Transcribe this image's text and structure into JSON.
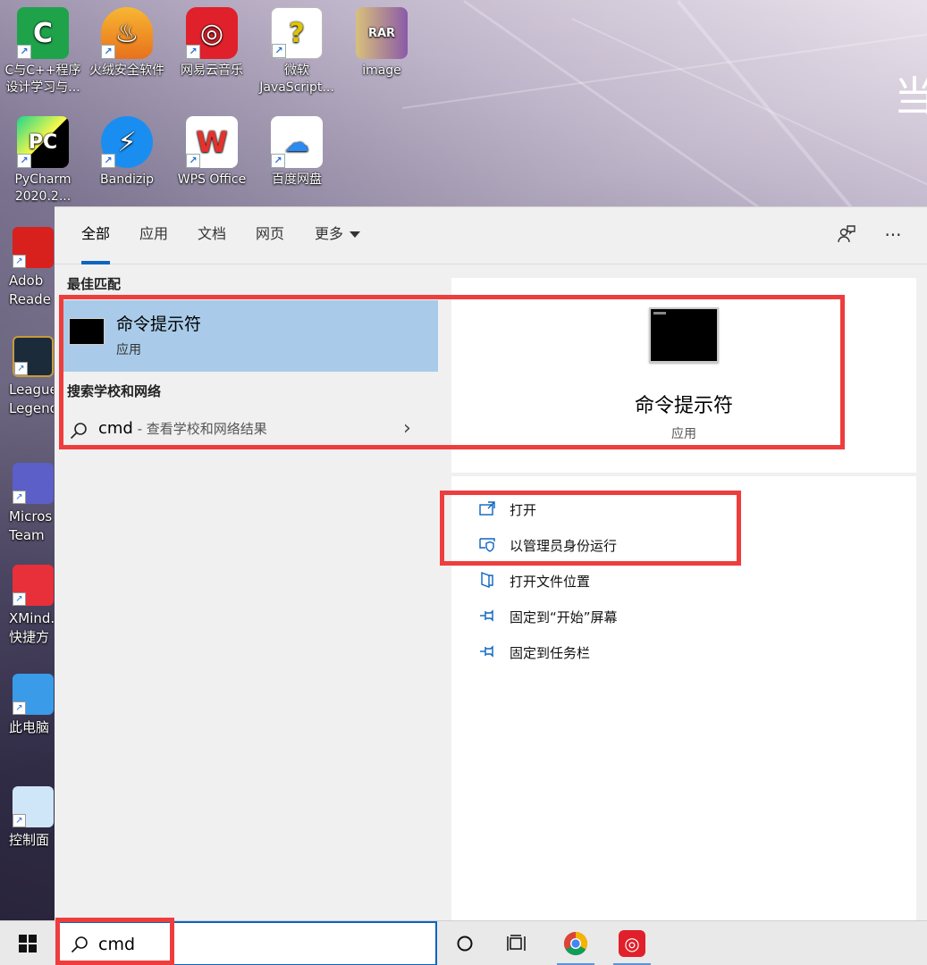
{
  "desktop": {
    "edge_glyph": "当",
    "icons": [
      {
        "label": "C与C++程序设计学习与...",
        "icon": "c-app-icon",
        "color": "#1ea34a"
      },
      {
        "label": "火绒安全软件",
        "icon": "huorong-icon",
        "color": "#f29a1c"
      },
      {
        "label": "网易云音乐",
        "icon": "netease-music-icon",
        "color": "#e0202a"
      },
      {
        "label": "微软 JavaScript...",
        "icon": "document-help-icon",
        "color": "#f5e04a"
      },
      {
        "label": "image",
        "icon": "rar-archive-icon",
        "color": "#8b5aa8"
      },
      {
        "label": "PyCharm 2020.2...",
        "icon": "pycharm-icon",
        "color": "#21d789"
      },
      {
        "label": "Bandizip",
        "icon": "bandizip-icon",
        "color": "#1a8ef0"
      },
      {
        "label": "WPS Office",
        "icon": "wps-icon",
        "color": "#e5322d"
      },
      {
        "label": "百度网盘",
        "icon": "baidu-netdisk-icon",
        "color": "#2a8bf2"
      }
    ],
    "partial_icons": [
      {
        "line1": "Adob",
        "line2": "Reade",
        "icon": "acrobat-icon",
        "color": "#d8201c"
      },
      {
        "line1": "League",
        "line2": "Legend",
        "icon": "league-icon",
        "color": "#c79b3b"
      },
      {
        "line1": "Micros",
        "line2": "Team",
        "icon": "teams-icon",
        "color": "#5b5fc7"
      },
      {
        "line1": "XMind.e",
        "line2": "快捷方",
        "icon": "xmind-icon",
        "color": "#e8303a"
      },
      {
        "line1": "此电脑",
        "line2": "",
        "icon": "computer-icon",
        "color": "#3a9be8"
      },
      {
        "line1": "控制面",
        "line2": "",
        "icon": "control-panel-icon",
        "color": "#3a8fd6"
      }
    ]
  },
  "search_panel": {
    "tabs": [
      {
        "label": "全部",
        "active": true
      },
      {
        "label": "应用",
        "active": false
      },
      {
        "label": "文档",
        "active": false
      },
      {
        "label": "网页",
        "active": false
      },
      {
        "label": "更多",
        "active": false
      }
    ],
    "feedback_icon": "feedback-icon",
    "more_options": "···",
    "best_match_title": "最佳匹配",
    "best_match": {
      "name": "命令提示符",
      "type": "应用"
    },
    "web_section_title": "搜索学校和网络",
    "web_result": {
      "query": "cmd",
      "hint": " - 查看学校和网络结果"
    },
    "preview": {
      "name": "命令提示符",
      "type": "应用"
    },
    "actions": [
      {
        "label": "打开",
        "icon": "open-icon"
      },
      {
        "label": "以管理员身份运行",
        "icon": "shield-icon"
      },
      {
        "label": "打开文件位置",
        "icon": "folder-icon"
      },
      {
        "label": "固定到“开始”屏幕",
        "icon": "pin-icon"
      },
      {
        "label": "固定到任务栏",
        "icon": "pin-icon"
      }
    ]
  },
  "taskbar": {
    "search_value": "cmd",
    "apps": [
      "chrome-icon",
      "netease-music-icon"
    ]
  },
  "colors": {
    "accent": "#0b64c0",
    "highlight_row": "#a9cbe9",
    "annotation_red": "#ee3d3d"
  }
}
